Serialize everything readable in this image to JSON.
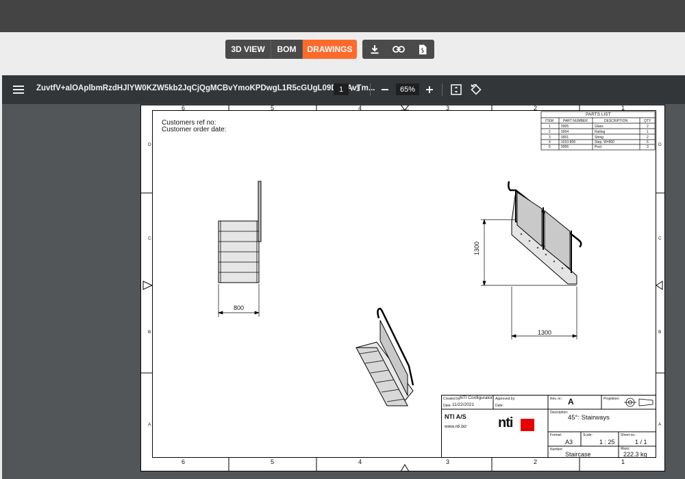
{
  "view_tabs": [
    {
      "label": "3D VIEW",
      "active": false
    },
    {
      "label": "BOM",
      "active": false
    },
    {
      "label": "DRAWINGS",
      "active": true
    }
  ],
  "tool_icons": [
    "download-icon",
    "link-icon",
    "pdf-document-icon"
  ],
  "accent_color": "#ff6a2b",
  "viewer": {
    "doc_title": "ZuvtfV+alOAplbmRzdHJlYW0KZW5kb2JqCjQgMCBvYmoKPDwgL1R5cGUgL09DRyAvTm...",
    "page_current": "1",
    "page_total": "/ 1",
    "zoom": "65%"
  },
  "drawing": {
    "col_labels": [
      "6",
      "5",
      "4",
      "3",
      "2",
      "1"
    ],
    "row_labels": [
      "D",
      "C",
      "B",
      "A"
    ],
    "customer_ref_label": "Customers ref no:",
    "customer_date_label": "Customer order date:",
    "parts_list": {
      "title": "PARTS LIST",
      "headers": [
        "ITEM",
        "PART NUMBER",
        "DESCRIPTION",
        "QTY"
      ],
      "rows": [
        [
          "1",
          "0005",
          "Glass",
          "2"
        ],
        [
          "2",
          "0004",
          "Railing",
          "1"
        ],
        [
          "3",
          "0001",
          "String",
          "2"
        ],
        [
          "4",
          "1010-800",
          "Step, W=800",
          "6"
        ],
        [
          "5",
          "0006",
          "Post",
          "3"
        ]
      ]
    },
    "dimensions": {
      "side_width": "800",
      "height": "1300",
      "run": "1300"
    },
    "title_block": {
      "created_by_label": "Created by:",
      "created_by": "NTI Configurator",
      "date_label": "Date:",
      "date": "11/22/2021",
      "approved_by_label": "Approved by:",
      "approved_date_label": "Date:",
      "rev_label": "Rev. nr.:",
      "rev": "A",
      "projection_label": "Projektion:",
      "company": "NTI A/S",
      "website": "www.nti.biz",
      "logo_text": "nti",
      "description_label": "Description:",
      "description": "45°:  Stairways",
      "format_label": "Format:",
      "format": "A3",
      "scale_label": "Scale:",
      "scale": "1 : 25",
      "sheet_label": "Sheet no.:",
      "sheet": "1 / 1",
      "number_label": "Number:",
      "number": "Staircase",
      "mass_label": "Mass:",
      "mass": "222.3 kg"
    }
  }
}
